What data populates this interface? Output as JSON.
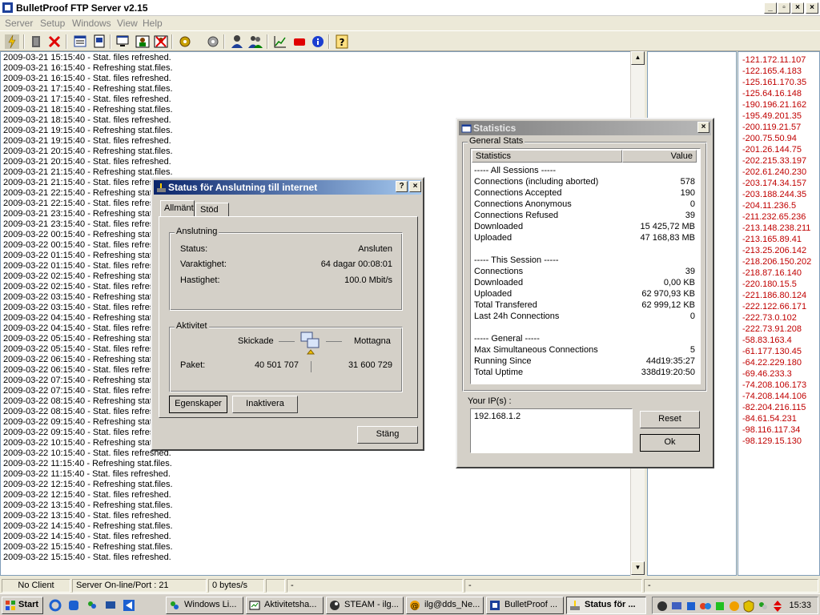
{
  "window": {
    "title": "BulletProof FTP Server v2.15"
  },
  "menu": [
    "Server",
    "Setup",
    "Windows",
    "View",
    "Help"
  ],
  "log_lines": [
    "2009-03-21 15:15:40 - Stat. files refreshed.",
    "2009-03-21 16:15:40 - Refreshing stat.files.",
    "2009-03-21 16:15:40 - Stat. files refreshed.",
    "2009-03-21 17:15:40 - Refreshing stat.files.",
    "2009-03-21 17:15:40 - Stat. files refreshed.",
    "2009-03-21 18:15:40 - Refreshing stat.files.",
    "2009-03-21 18:15:40 - Stat. files refreshed.",
    "2009-03-21 19:15:40 - Refreshing stat.files.",
    "2009-03-21 19:15:40 - Stat. files refreshed.",
    "2009-03-21 20:15:40 - Refreshing stat.files.",
    "2009-03-21 20:15:40 - Stat. files refreshed.",
    "2009-03-21 21:15:40 - Refreshing stat.files.",
    "2009-03-21 21:15:40 - Stat. files refresh",
    "2009-03-21 22:15:40 - Refreshing stat.",
    "2009-03-21 22:15:40 - Stat. files refresh",
    "2009-03-21 23:15:40 - Refreshing stat.",
    "2009-03-21 23:15:40 - Stat. files refresh",
    "2009-03-22 00:15:40 - Refreshing stat.",
    "2009-03-22 00:15:40 - Stat. files refresh",
    "2009-03-22 01:15:40 - Refreshing stat.",
    "2009-03-22 01:15:40 - Stat. files refresh",
    "2009-03-22 02:15:40 - Refreshing stat.",
    "2009-03-22 02:15:40 - Stat. files refresh",
    "2009-03-22 03:15:40 - Refreshing stat.",
    "2009-03-22 03:15:40 - Stat. files refresh",
    "2009-03-22 04:15:40 - Refreshing stat.",
    "2009-03-22 04:15:40 - Stat. files refresh",
    "2009-03-22 05:15:40 - Refreshing stat.",
    "2009-03-22 05:15:40 - Stat. files refresh",
    "2009-03-22 06:15:40 - Refreshing stat.",
    "2009-03-22 06:15:40 - Stat. files refresh",
    "2009-03-22 07:15:40 - Refreshing stat.",
    "2009-03-22 07:15:40 - Stat. files refresh",
    "2009-03-22 08:15:40 - Refreshing stat.",
    "2009-03-22 08:15:40 - Stat. files refresh",
    "2009-03-22 09:15:40 - Refreshing stat.",
    "2009-03-22 09:15:40 - Stat. files refresh",
    "2009-03-22 10:15:40 - Refreshing stat.",
    "2009-03-22 10:15:40 - Stat. files refreshed.",
    "2009-03-22 11:15:40 - Refreshing stat.files.",
    "2009-03-22 11:15:40 - Stat. files refreshed.",
    "2009-03-22 12:15:40 - Refreshing stat.files.",
    "2009-03-22 12:15:40 - Stat. files refreshed.",
    "2009-03-22 13:15:40 - Refreshing stat.files.",
    "2009-03-22 13:15:40 - Stat. files refreshed.",
    "2009-03-22 14:15:40 - Refreshing stat.files.",
    "2009-03-22 14:15:40 - Stat. files refreshed.",
    "2009-03-22 15:15:40 - Refreshing stat.files.",
    "2009-03-22 15:15:40 - Stat. files refreshed."
  ],
  "ip_list": [
    "-121.172.11.107",
    "-122.165.4.183",
    "-125.161.170.35",
    "-125.64.16.148",
    "-190.196.21.162",
    "-195.49.201.35",
    "-200.119.21.57",
    "-200.75.50.94",
    "-201.26.144.75",
    "-202.215.33.197",
    "-202.61.240.230",
    "-203.174.34.157",
    "-203.188.244.35",
    "-204.11.236.5",
    "-211.232.65.236",
    "-213.148.238.211",
    "-213.165.89.41",
    "-213.25.206.142",
    "-218.206.150.202",
    "-218.87.16.140",
    "-220.180.15.5",
    "-221.186.80.124",
    "-222.122.66.171",
    "-222.73.0.102",
    "-222.73.91.208",
    "-58.83.163.4",
    "-61.177.130.45",
    "-64.22.229.180",
    "-69.46.233.3",
    "-74.208.106.173",
    "-74.208.144.106",
    "-82.204.216.115",
    "-84.61.54.231",
    "-98.116.117.34",
    "-98.129.15.130"
  ],
  "statusbar": {
    "client": "No Client",
    "server": "Server On-line/Port : 21",
    "bytes": "0 bytes/s",
    "s4": "-",
    "s5": "-",
    "s6": "-"
  },
  "conn_dialog": {
    "title": "Status för Anslutning till internet",
    "tab_general": "Allmänt",
    "tab_support": "Stöd",
    "grp_connection": "Anslutning",
    "status_label": "Status:",
    "status_value": "Ansluten",
    "duration_label": "Varaktighet:",
    "duration_value": "64 dagar 00:08:01",
    "speed_label": "Hastighet:",
    "speed_value": "100.0 Mbit/s",
    "grp_activity": "Aktivitet",
    "sent_label": "Skickade",
    "received_label": "Mottagna",
    "packets_label": "Paket:",
    "packets_sent": "40 501 707",
    "packets_received": "31 600 729",
    "btn_properties": "Egenskaper",
    "btn_disable": "Inaktivera",
    "btn_close": "Stäng",
    "help_glyph": "?",
    "close_glyph": "×"
  },
  "stats_dialog": {
    "title": "Statistics",
    "grp_general": "General Stats",
    "col_stat": "Statistics",
    "col_value": "Value",
    "rows": [
      {
        "k": "----- All Sessions -----",
        "v": ""
      },
      {
        "k": "Connections (including aborted)",
        "v": "578"
      },
      {
        "k": "Connections Accepted",
        "v": "190"
      },
      {
        "k": "Connections Anonymous",
        "v": "0"
      },
      {
        "k": "Connections Refused",
        "v": "39"
      },
      {
        "k": "Downloaded",
        "v": "15 425,72 MB"
      },
      {
        "k": "Uploaded",
        "v": "47 168,83 MB"
      },
      {
        "k": "",
        "v": ""
      },
      {
        "k": "----- This Session -----",
        "v": ""
      },
      {
        "k": "Connections",
        "v": "39"
      },
      {
        "k": "Downloaded",
        "v": "0,00 KB"
      },
      {
        "k": "Uploaded",
        "v": "62 970,93 KB"
      },
      {
        "k": "Total Transfered",
        "v": "62 999,12 KB"
      },
      {
        "k": "Last 24h Connections",
        "v": "0"
      },
      {
        "k": "",
        "v": ""
      },
      {
        "k": "----- General -----",
        "v": ""
      },
      {
        "k": "Max Simultaneous Connections",
        "v": "5"
      },
      {
        "k": "Running Since",
        "v": "44d19:35:27"
      },
      {
        "k": "Total Uptime",
        "v": "338d19:20:50"
      }
    ],
    "your_ip_label": "Your IP(s) :",
    "your_ip_value": "192.168.1.2",
    "btn_reset": "Reset",
    "btn_ok": "Ok",
    "close_glyph": "×"
  },
  "taskbar": {
    "start": "Start",
    "buttons": [
      "Windows Li...",
      "Aktivitetsha...",
      "STEAM - ilg...",
      "ilg@dds_Ne...",
      "BulletProof ...",
      "Status för ..."
    ],
    "clock": "15:33"
  },
  "colors": {
    "ip_red": "#c00000",
    "title_blue": "#0a246a"
  }
}
